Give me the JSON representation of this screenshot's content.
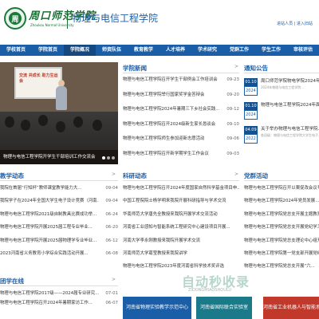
{
  "header": {
    "school_name": "周口师范学院",
    "school_en": "Zhoukou Normal University",
    "college_name": "物理与电信工程学院",
    "top_links": "进站人员 | 进入旧站"
  },
  "nav": {
    "items": [
      "学校首页",
      "学院首页",
      "学院概况",
      "师资队伍",
      "教育教学",
      "人才培养",
      "学术研究",
      "党群工作",
      "学生工作",
      "审核评估"
    ]
  },
  "hero": {
    "board_text": "交流 共成长 助力生运会",
    "caption": "物理与电信工程学院开学生干部培训工作交流会"
  },
  "news": {
    "title": "学院新闻",
    "more": ">",
    "items": [
      {
        "text": "物理与电信工程学院召开学生干部例会工作培训会",
        "date": "09-23"
      },
      {
        "text": "物理与电信工程学院举行国家奖学金答辩会",
        "date": "09-20"
      },
      {
        "text": "物理与电信工程学院2024年暑期三下乡社会实践...",
        "date": "09-12"
      },
      {
        "text": "物理与电信工程学院召开2024级新生家长恳谈会",
        "date": "09-10"
      },
      {
        "text": "物理与电信工程学院师生参加迎新志愿活动",
        "date": "09-06"
      },
      {
        "text": "物理与电信工程学院召开新学期学生工作会议",
        "date": "09-03"
      }
    ]
  },
  "notice": {
    "title": "通知公告",
    "more": ">",
    "items": [
      {
        "md": "01.10",
        "yr": "2024",
        "text": "周口师范学院物电学院2024年...",
        "sub": "2024年物理与电信工程学院..."
      },
      {
        "md": "01.10",
        "yr": "2024",
        "text": "物理与电信工程学院2024年面...",
        "sub": ""
      },
      {
        "md": "04.09",
        "yr": "2022",
        "text": "关于举办物理与电信工程学院...",
        "sub": "各班级：物理与电信工程学院大学生电子..."
      }
    ]
  },
  "teaching": {
    "title": "教学动态",
    "more": ">",
    "items": [
      {
        "text": "我院在首届“行知杯”教师课堂教学能力大...",
        "date": "09-04"
      },
      {
        "text": "我院学子在2024年全国大学生电子设计竞赛（河南...",
        "date": "09-04"
      },
      {
        "text": "物理与电信工程学院2021级自制教具比赛成功举...",
        "date": "06-24"
      },
      {
        "text": "物理与电信工程学院开展2025届工程专业毕业...",
        "date": "06-20"
      },
      {
        "text": "物理与电信工程学院开展2025届物理学专业毕业...",
        "date": "06-12"
      },
      {
        "text": "2023河南省义务教育小学综合实践活动开展...",
        "date": "06-08"
      }
    ]
  },
  "research": {
    "title": "科研动态",
    "more": ">",
    "items": [
      {
        "text": "物理与电信工程学院召开2024年度国家自然科学基金项目申...",
        "date": ""
      },
      {
        "text": "中国工程院院士杨学明来我院开展科研指导与学术交流",
        "date": ""
      },
      {
        "text": "华南师范大学唐先全教授来我院开展学术交流活动",
        "date": ""
      },
      {
        "text": "河南省工业感知与智能系统工程研究中心建设项目开展...",
        "date": ""
      },
      {
        "text": "河南大学李永刚教授来我院开展学术交流",
        "date": ""
      },
      {
        "text": "河南师范大学葛莹教授来我院讲学",
        "date": ""
      },
      {
        "text": "物理与电信工程学院2023年度河南省科学技术奖评选",
        "date": ""
      }
    ]
  },
  "party": {
    "title": "党群活动",
    "more": ">",
    "items": [
      {
        "text": "物理与电信工程学院召开以案促改会议专题会"
      },
      {
        "text": "物理与电信工程学院2024年党员发展..."
      },
      {
        "text": "物理与电信工程学院党总支开展主题教育中心组学习..."
      },
      {
        "text": "物理与电信工程学院党总支开展党纪学习教育..."
      },
      {
        "text": "物理与电信工程学院党总支理论中心组开展“..."
      },
      {
        "text": "物理与电信工程学院第一党支部开展党纪..."
      },
      {
        "text": "物理与电信工程学院党总支开展“六..."
      }
    ]
  },
  "students": {
    "title": "团学在线",
    "more": ">",
    "items": [
      {
        "text": "物理与电信工程学院2017级——2024届专业研究...",
        "date": "07-01"
      },
      {
        "text": "物理与电信工程学院召开2024年暑期家访工作...",
        "date": "06-07"
      }
    ]
  },
  "banners": [
    {
      "label": "河南省物理实验教学示范中心",
      "color": "#1b5ea8"
    },
    {
      "label": "河南省国际联合实验室",
      "color": "#1b7a8a"
    },
    {
      "label": "河南省工业机器人与智能系统...",
      "color": "#c0392b"
    }
  ],
  "watermark": {
    "main": "自动秒收录",
    "sub": "ZIDONGMIAOSHOULU"
  }
}
